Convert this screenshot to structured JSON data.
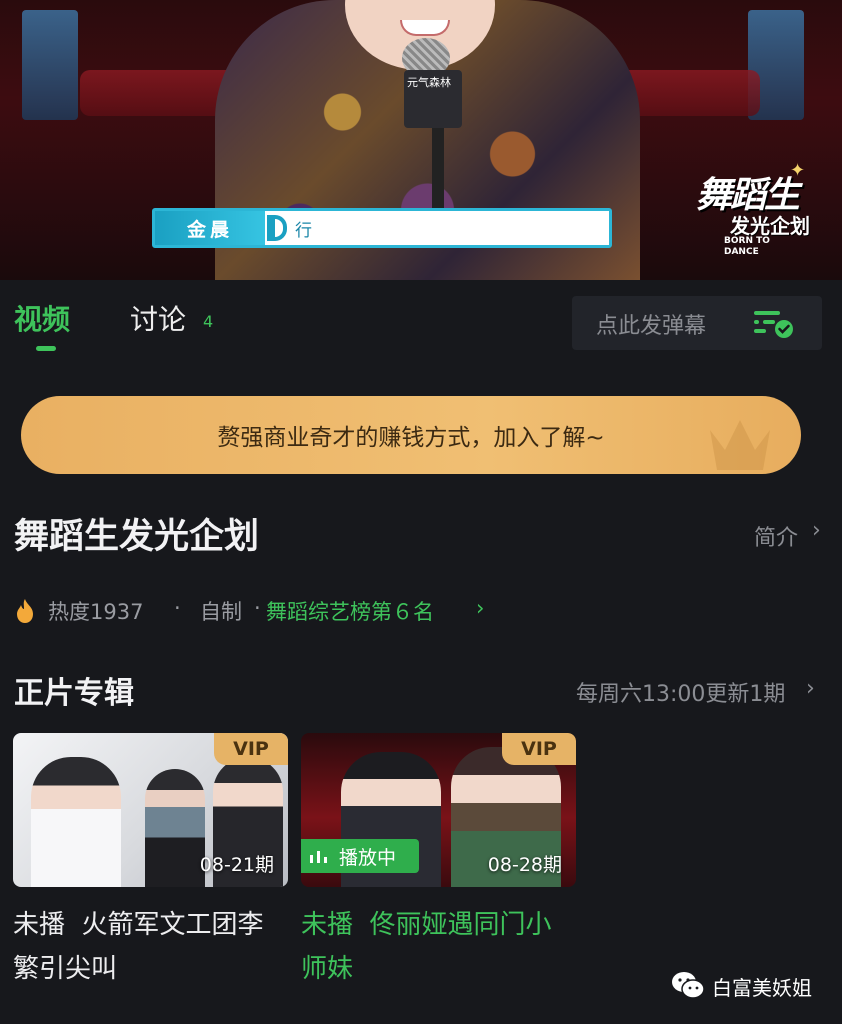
{
  "player": {
    "mic_text": "元气森林",
    "name_banner": {
      "name": "金晨",
      "caption": "行"
    },
    "logo": {
      "title": "舞蹈生",
      "subtitle": "发光企划",
      "english": "BORN TO DANCE"
    }
  },
  "tabs": [
    {
      "label": "视频",
      "active": true
    },
    {
      "label": "讨论",
      "count": "4",
      "active": false
    }
  ],
  "danmaku": {
    "placeholder": "点此发弹幕",
    "icon": "danmaku-toggle-icon"
  },
  "promo": {
    "text": "赘强商业奇才的赚钱方式，加入了解~"
  },
  "show": {
    "title": "舞蹈生发光企划",
    "intro_label": "简介",
    "heat_label": "热度1937",
    "separator": "·",
    "type_label": "自制",
    "rank_label": "舞蹈综艺榜第６名"
  },
  "episodes_section": {
    "title": "正片专辑",
    "schedule": "每周六13:00更新1期",
    "items": [
      {
        "badge": "VIP",
        "date": "08-21期",
        "title_line1": "未播  火箭军文工团李",
        "title_line2": "繁引尖叫",
        "playing": false
      },
      {
        "badge": "VIP",
        "date": "08-28期",
        "title_line1": "未播  佟丽娅遇同门小",
        "title_line2": "师妹",
        "playing": true,
        "playing_label": "播放中"
      }
    ]
  },
  "watermark": {
    "text": "白富美妖姐",
    "icon": "wechat-icon"
  },
  "colors": {
    "accent": "#3ec35b",
    "background": "#17181c",
    "promo": "#efbb6e",
    "vip": "#e6b366"
  }
}
